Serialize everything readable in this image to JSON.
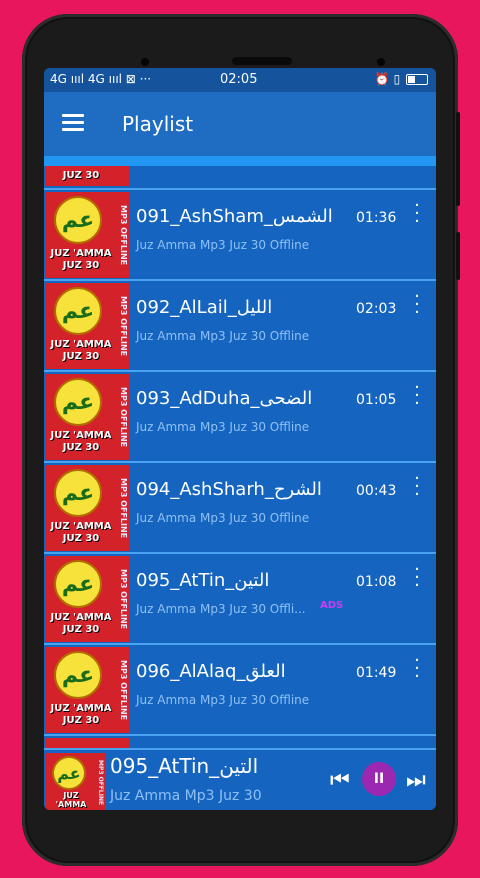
{
  "statusbar": {
    "left": "4G ıııl 4G ıııl ⊠ ···",
    "time": "02:05",
    "right_icons": "⏰ ▯"
  },
  "appbar": {
    "title": "Playlist"
  },
  "playlist": {
    "thumb_text_top": "JUZ 'AMMA",
    "thumb_text_bottom": "JUZ 30",
    "thumb_side_text": "MP3 OFFLINE",
    "partial_label": "JUZ 30",
    "items": [
      {
        "title": "091_AshSham_الشمس",
        "duration": "01:36",
        "subtitle": "Juz Amma Mp3 Juz 30 Offline"
      },
      {
        "title": "092_AlLail_الليل",
        "duration": "02:03",
        "subtitle": "Juz Amma Mp3 Juz 30 Offline"
      },
      {
        "title": "093_AdDuha_الضحى",
        "duration": "01:05",
        "subtitle": "Juz Amma Mp3 Juz 30 Offline"
      },
      {
        "title": "094_AshSharh_الشرح",
        "duration": "00:43",
        "subtitle": "Juz Amma Mp3 Juz 30 Offline"
      },
      {
        "title": "095_AtTin_التين",
        "duration": "01:08",
        "subtitle": "Juz Amma Mp3 Juz 30 Offli...",
        "badge": "ADS"
      },
      {
        "title": "096_AlAlaq_العلق",
        "duration": "01:49",
        "subtitle": "Juz Amma Mp3 Juz 30 Offline"
      }
    ]
  },
  "player": {
    "title": "095_AtTin_التين",
    "subtitle": "Juz Amma Mp3 Juz 30",
    "prev_icon": "⏮",
    "pause_icon": "II",
    "next_icon": "⏭"
  },
  "colors": {
    "background": "#e8175d",
    "appbar": "#1f6dc2",
    "row": "#1565c0",
    "accent_pause": "#9c27b0"
  }
}
